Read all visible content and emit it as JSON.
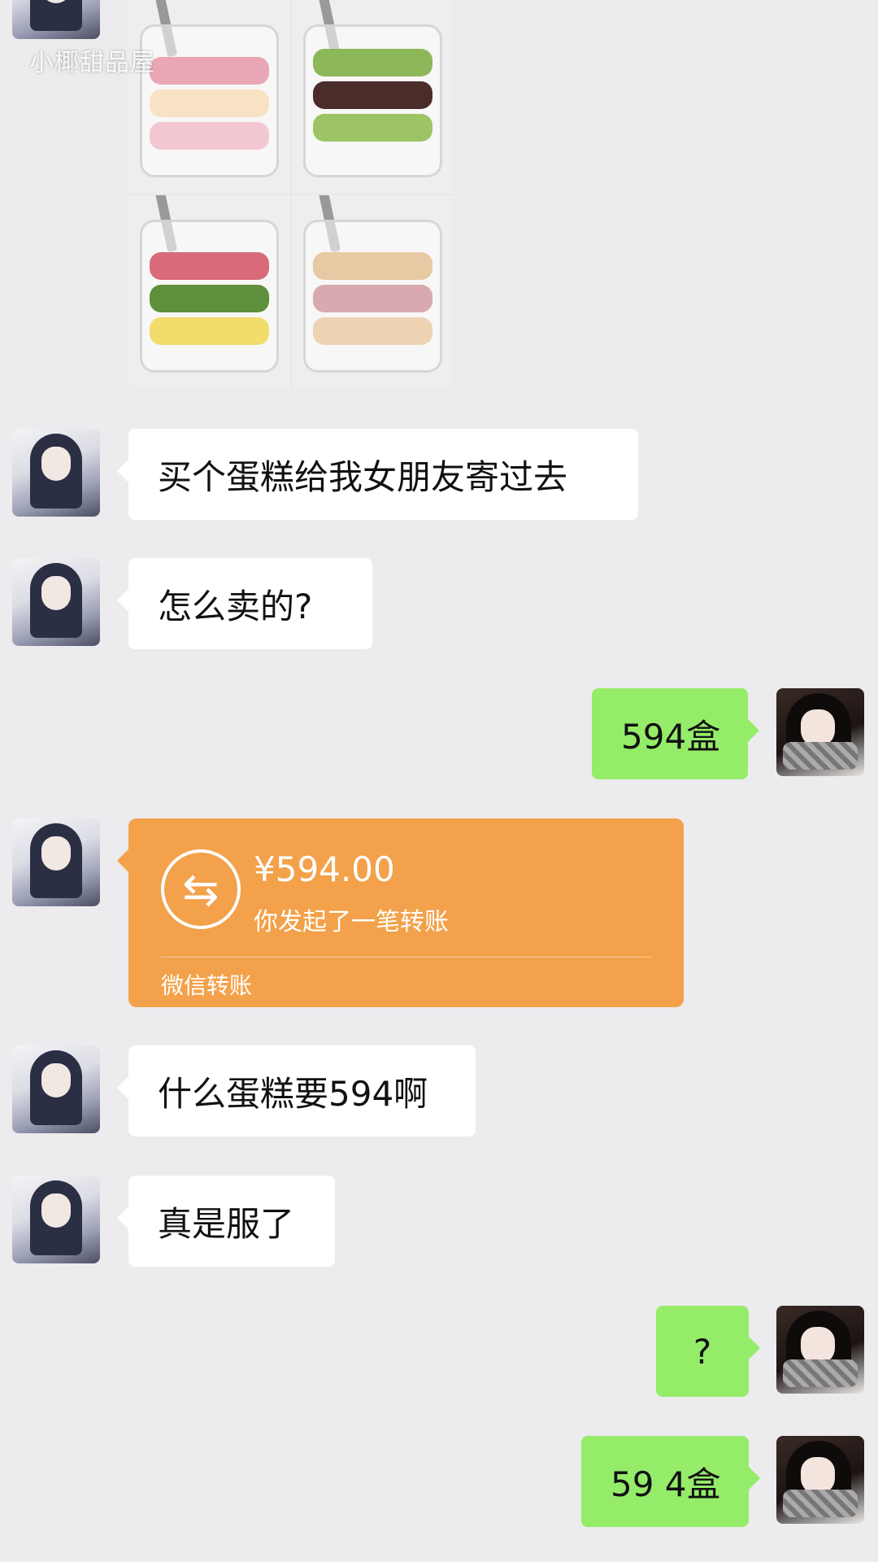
{
  "watermark": "小椰甜品屋",
  "messages": [
    {
      "id": "m1",
      "side": "left",
      "text": "买个蛋糕给我女朋友寄过去"
    },
    {
      "id": "m2",
      "side": "left",
      "text": "怎么卖的?"
    },
    {
      "id": "m3",
      "side": "right",
      "text": "594盒"
    },
    {
      "id": "m5",
      "side": "left",
      "text": "什么蛋糕要594啊"
    },
    {
      "id": "m6",
      "side": "left",
      "text": "真是服了"
    },
    {
      "id": "m7",
      "side": "right",
      "text": "?"
    },
    {
      "id": "m8",
      "side": "right",
      "text": "59 4盒"
    }
  ],
  "transfer": {
    "icon": "transfer-arrows-icon",
    "amount": "¥594.00",
    "description": "你发起了一笔转账",
    "footer": "微信转账"
  },
  "colors": {
    "background": "#ECEBED",
    "bubble_self": "#95EC69",
    "bubble_other": "#FFFFFF",
    "transfer": "#F3A14A"
  }
}
